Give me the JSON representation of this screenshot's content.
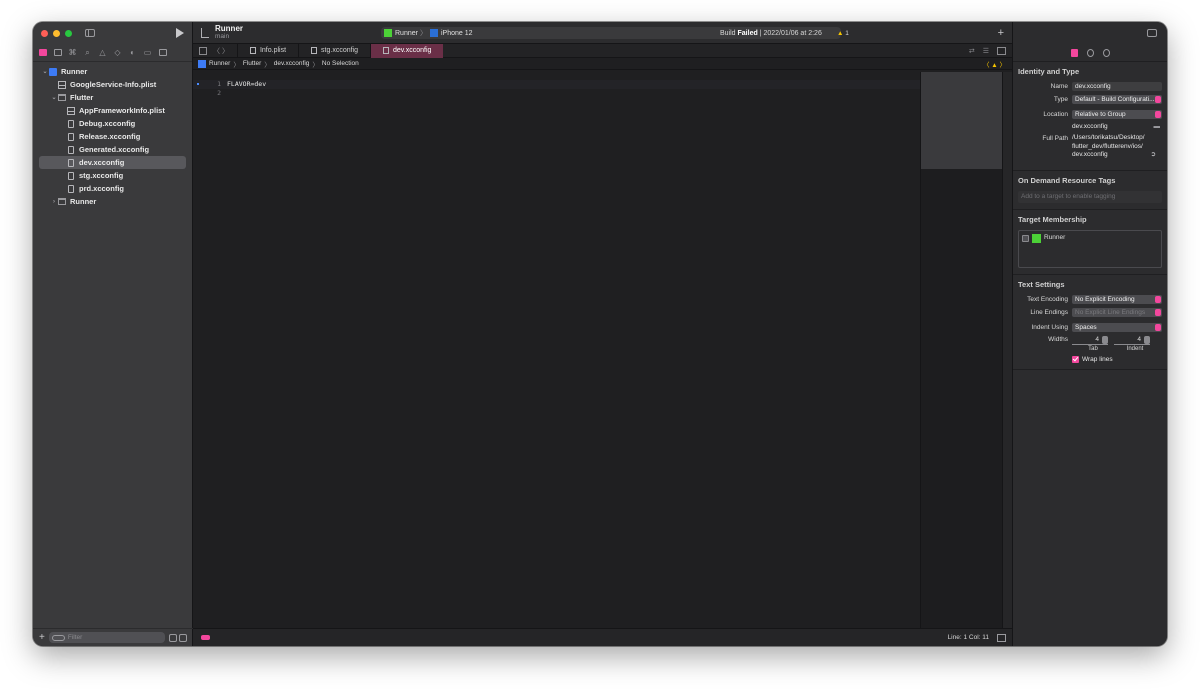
{
  "toolbar": {
    "project": "Runner",
    "branch": "main",
    "scheme": "Runner",
    "device": "iPhone 12",
    "build_prefix": "Build ",
    "build_status": "Failed",
    "build_suffix": " | 2022/01/06 at 2:26",
    "warning_count": "1",
    "add": "+"
  },
  "navigator": {
    "tree": [
      {
        "label": "Runner",
        "depth": 0,
        "icon": "project-icon",
        "disclosure": "⌄"
      },
      {
        "label": "GoogleService-Info.plist",
        "depth": 1,
        "icon": "plist-icon"
      },
      {
        "label": "Flutter",
        "depth": 1,
        "icon": "folder-icon",
        "disclosure": "⌄"
      },
      {
        "label": "AppFrameworkInfo.plist",
        "depth": 2,
        "icon": "plist-icon"
      },
      {
        "label": "Debug.xcconfig",
        "depth": 2,
        "icon": "document-icon"
      },
      {
        "label": "Release.xcconfig",
        "depth": 2,
        "icon": "document-icon"
      },
      {
        "label": "Generated.xcconfig",
        "depth": 2,
        "icon": "document-icon"
      },
      {
        "label": "dev.xcconfig",
        "depth": 2,
        "icon": "document-icon",
        "selected": true
      },
      {
        "label": "stg.xcconfig",
        "depth": 2,
        "icon": "document-icon"
      },
      {
        "label": "prd.xcconfig",
        "depth": 2,
        "icon": "document-icon"
      },
      {
        "label": "Runner",
        "depth": 1,
        "icon": "folder-icon",
        "disclosure": "›"
      }
    ],
    "filter_placeholder": "Filter"
  },
  "tabs": [
    {
      "label": "Info.plist",
      "active": false
    },
    {
      "label": "stg.xcconfig",
      "active": false
    },
    {
      "label": "dev.xcconfig",
      "active": true
    }
  ],
  "jumpbar": {
    "items": [
      "Runner",
      "Flutter",
      "dev.xcconfig",
      "No Selection"
    ]
  },
  "editor": {
    "lines": [
      {
        "number": "1",
        "text": "FLAVOR=dev"
      },
      {
        "number": "2",
        "text": ""
      }
    ],
    "position": "Line: 1  Col: 11"
  },
  "inspector": {
    "identity": {
      "title": "Identity and Type",
      "name_label": "Name",
      "name_value": "dev.xcconfig",
      "type_label": "Type",
      "type_value": "Default - Build Configurati...",
      "location_label": "Location",
      "location_value": "Relative to Group",
      "location_file": "dev.xcconfig",
      "fullpath_label": "Full Path",
      "fullpath_value": "/Users/torikatsu/Desktop/ flutter_dev/flutterenv/ios/ dev.xcconfig"
    },
    "tags": {
      "title": "On Demand Resource Tags",
      "placeholder": "Add to a target to enable tagging"
    },
    "membership": {
      "title": "Target Membership",
      "target": "Runner"
    },
    "text_settings": {
      "title": "Text Settings",
      "encoding_label": "Text Encoding",
      "encoding_value": "No Explicit Encoding",
      "endings_label": "Line Endings",
      "endings_value": "No Explicit Line Endings",
      "indent_label": "Indent Using",
      "indent_value": "Spaces",
      "widths_label": "Widths",
      "tab_value": "4",
      "indent_width_value": "4",
      "tab_label": "Tab",
      "indent_sub_label": "Indent",
      "wrap_label": "Wrap lines",
      "wrap_checked": true
    }
  },
  "colors": {
    "accent": "#f3479d",
    "selection": "#58585c",
    "warning": "#f5c400"
  }
}
